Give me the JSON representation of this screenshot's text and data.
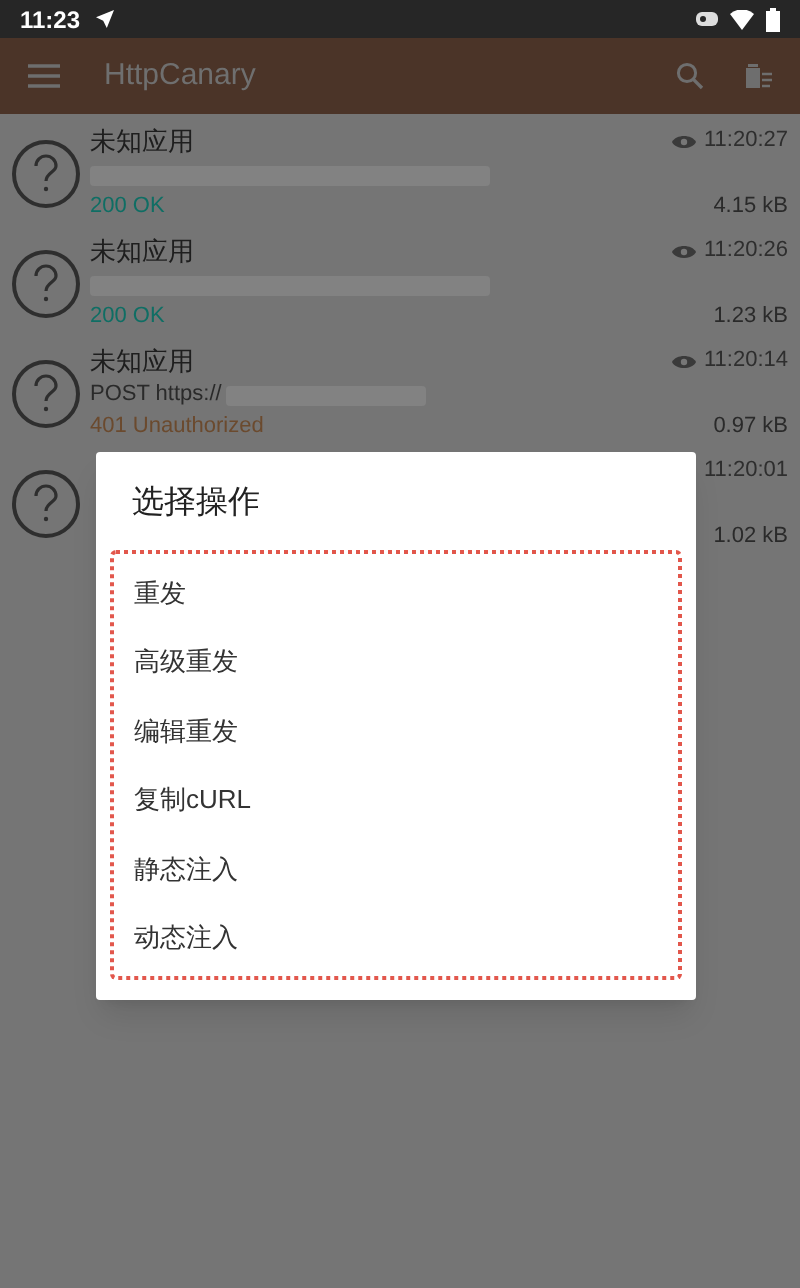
{
  "status_bar": {
    "time": "11:23"
  },
  "app_bar": {
    "title": "HttpCanary"
  },
  "requests": [
    {
      "app": "未知应用",
      "time": "11:20:27",
      "status": "200 OK",
      "color": "#0f6e64",
      "size": "4.15 kB"
    },
    {
      "app": "未知应用",
      "time": "11:20:26",
      "status": "200 OK",
      "color": "#0f6e64",
      "size": "1.23 kB"
    },
    {
      "app": "未知应用",
      "time": "11:20:14",
      "url": "POST https://",
      "status": "401 Unauthorized",
      "color": "#6b4a2e",
      "size": "0.97 kB"
    },
    {
      "time": "11:20:01",
      "size": "1.02 kB"
    }
  ],
  "dialog": {
    "title": "选择操作",
    "options": [
      "重发",
      "高级重发",
      "编辑重发",
      "复制cURL",
      "静态注入",
      "动态注入"
    ]
  }
}
